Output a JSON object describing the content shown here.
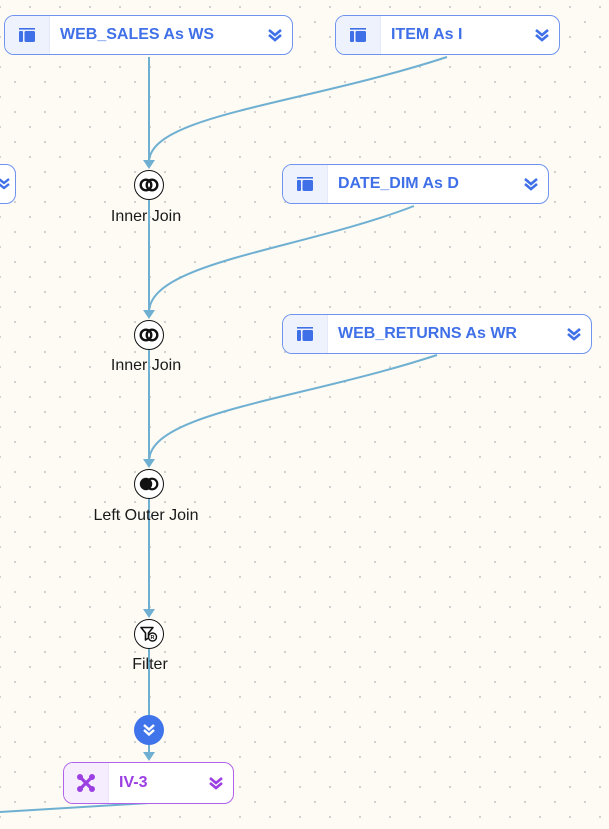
{
  "canvas": {
    "background": "#fdfbf4",
    "edge_color": "#6fb0d2",
    "accent_blue": "#4070e8",
    "accent_purple": "#9b3fe3"
  },
  "tables": [
    {
      "id": "web_sales",
      "label": "WEB_SALES As WS",
      "icon": "table-icon",
      "menu_icon": "chevron-double-down-icon"
    },
    {
      "id": "item",
      "label": "ITEM As I",
      "icon": "table-icon",
      "menu_icon": "chevron-double-down-icon"
    },
    {
      "id": "date_dim",
      "label": "DATE_DIM As D",
      "icon": "table-icon",
      "menu_icon": "chevron-double-down-icon"
    },
    {
      "id": "web_returns",
      "label": "WEB_RETURNS As WR",
      "icon": "table-icon",
      "menu_icon": "chevron-double-down-icon"
    }
  ],
  "operations": [
    {
      "id": "join1",
      "label": "Inner Join",
      "icon": "inner-join-icon"
    },
    {
      "id": "join2",
      "label": "Inner Join",
      "icon": "inner-join-icon"
    },
    {
      "id": "join3",
      "label": "Left Outer Join",
      "icon": "left-outer-join-icon"
    },
    {
      "id": "filter",
      "label": "Filter",
      "icon": "filter-icon"
    }
  ],
  "expand_button": {
    "icon": "chevron-double-down-icon"
  },
  "result_node": {
    "label": "IV-3",
    "icon": "view-node-icon",
    "menu_icon": "chevron-double-down-icon"
  },
  "offscreen_node": {
    "menu_icon": "chevron-double-down-icon"
  }
}
